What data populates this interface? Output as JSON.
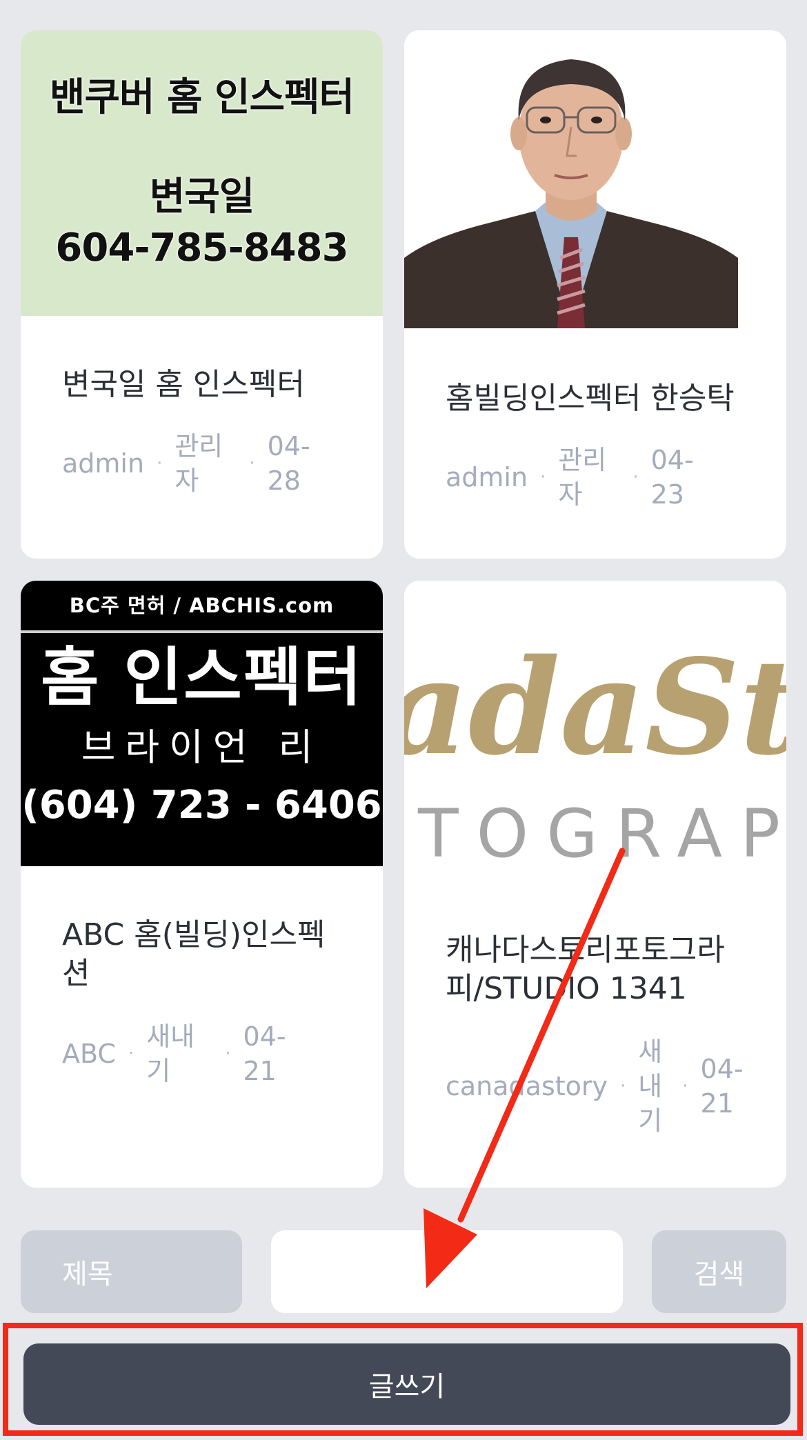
{
  "cards": [
    {
      "thumb_lines": [
        "밴쿠버 홈 인스펙터",
        "변국일",
        "604-785-8483"
      ],
      "title": "변국일 홈 인스펙터",
      "author": "admin",
      "category": "관리자",
      "date": "04-28"
    },
    {
      "thumb_alt": "portrait photo",
      "title": "홈빌딩인스펙터 한승탁",
      "author": "admin",
      "category": "관리자",
      "date": "04-23"
    },
    {
      "thumb_top": "BC주 면허  /  ABCHIS.com",
      "thumb_big": "홈 인스펙터",
      "thumb_name": "브라이언 리",
      "thumb_tel": "(604) 723 - 6406",
      "title": "ABC 홈(빌딩)인스펙션",
      "author": "ABC",
      "category": "새내기",
      "date": "04-21"
    },
    {
      "thumb_logo_script": "adaSt",
      "thumb_logo_caps": "TOGRAP",
      "title": "캐나다스토리포토그라피/STUDIO 1341",
      "author": "canadastory",
      "category": "새내기",
      "date": "04-21"
    }
  ],
  "search": {
    "field_select": "제목",
    "input_value": "",
    "button_label": "검색"
  },
  "write_button_label": "글쓰기",
  "colors": {
    "background": "#e7e8ec",
    "annotation_red": "#f22a16",
    "write_button": "#434956",
    "meta_text": "#a4abbb"
  },
  "separator_char": "·"
}
